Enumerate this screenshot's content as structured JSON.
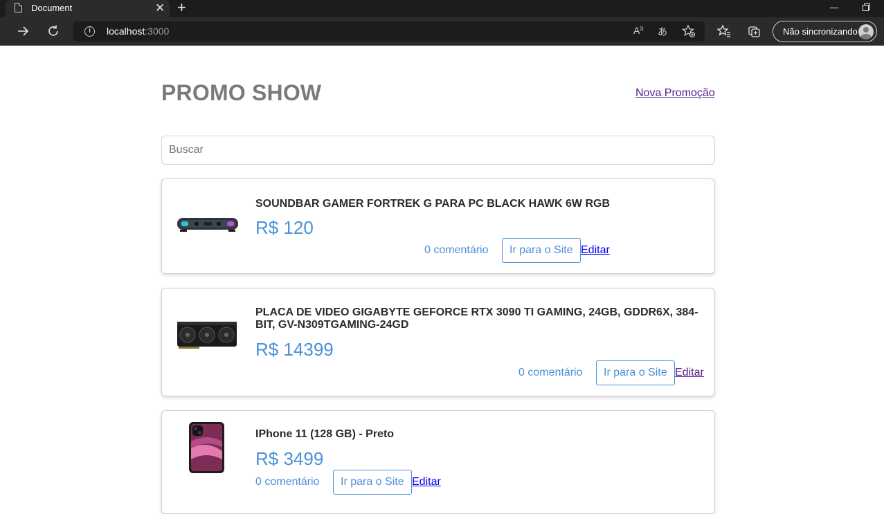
{
  "browser": {
    "tab_title": "Document",
    "url_host": "localhost",
    "url_port": ":3000",
    "sync_label": "Não sincronizando",
    "icons": [
      "document-icon",
      "close-icon",
      "plus-icon",
      "back-icon",
      "refresh-icon",
      "info-icon",
      "read-aloud-icon",
      "translate-icon",
      "favorite-add-icon",
      "favorites-icon",
      "collections-icon",
      "avatar-icon",
      "minimize-icon",
      "restore-icon"
    ]
  },
  "page": {
    "title": "PROMO SHOW",
    "new_promo_link": "Nova Promoção",
    "search_placeholder": "Buscar"
  },
  "promotions": [
    {
      "title": "SOUNDBAR GAMER FORTREK G PARA PC BLACK HAWK 6W RGB",
      "price": "R$ 120",
      "comments": "0 comentário",
      "site_button": "Ir para o Site",
      "edit_link": "Editar"
    },
    {
      "title": "PLACA DE VIDEO GIGABYTE GEFORCE RTX 3090 TI GAMING, 24GB, GDDR6X, 384-BIT, GV-N309TGAMING-24GD",
      "price": "R$ 14399",
      "comments": "0 comentário",
      "site_button": "Ir para o Site",
      "edit_link": "Editar"
    },
    {
      "title": "IPhone 11 (128 GB) - Preto",
      "price": "R$ 3499",
      "comments": "0 comentário",
      "site_button": "Ir para o Site",
      "edit_link": "Editar"
    }
  ],
  "colors": {
    "accent": "#4a90d9",
    "title_gray": "#7a7a7a",
    "visited_link": "#551a8b",
    "link": "#0000ee"
  }
}
